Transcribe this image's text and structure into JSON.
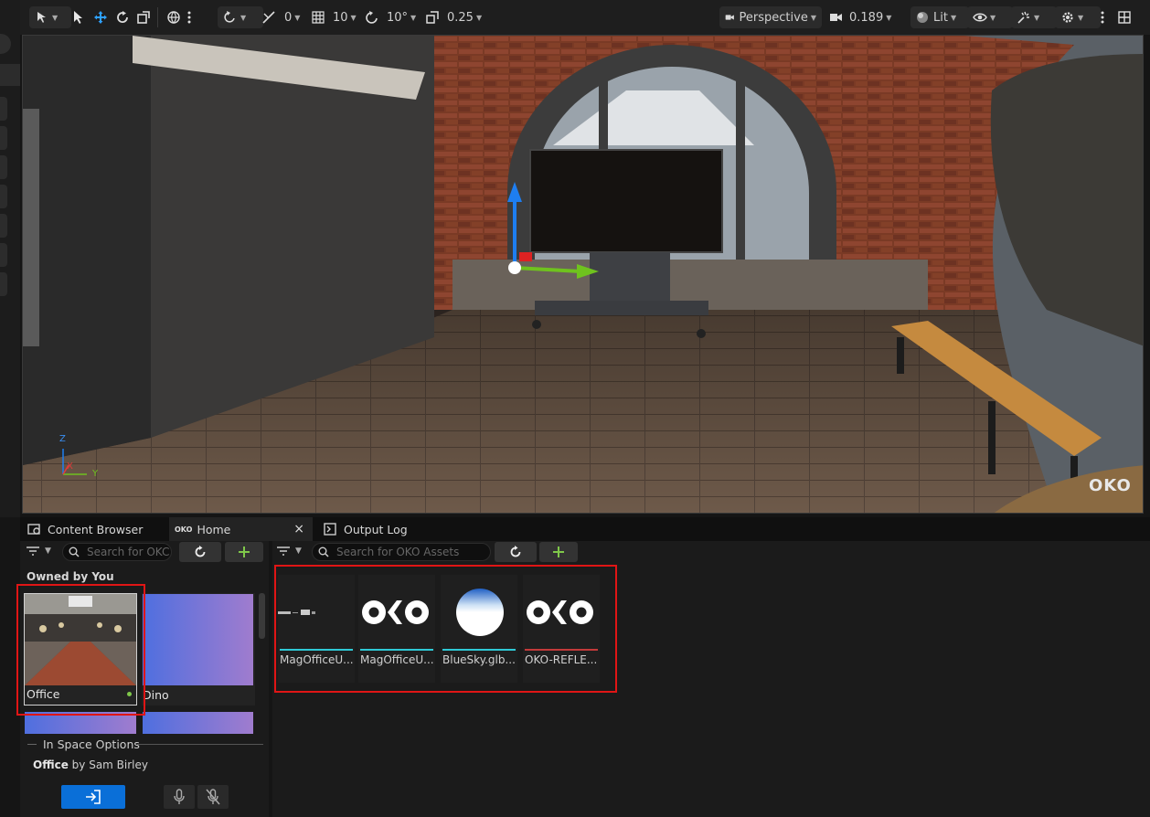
{
  "toolbar": {
    "snap_value": "0",
    "grid_value": "10",
    "rotation_value": "10°",
    "scale_value": "0.25",
    "perspective_label": "Perspective",
    "camera_speed": "0.189",
    "lit_label": "Lit"
  },
  "viewport": {
    "watermark": "OKO",
    "axis_labels": [
      "Z",
      "X",
      "Y"
    ]
  },
  "tabs": {
    "content_browser": "Content Browser",
    "home": "Home",
    "home_close": "×",
    "output_log": "Output Log"
  },
  "left_panel": {
    "search_placeholder": "Search for OKC",
    "section_title": "Owned by You",
    "spaces": [
      {
        "label": "Office"
      },
      {
        "label": "Dino"
      }
    ],
    "in_space_options": "In Space Options",
    "space_name": "Office",
    "space_owner": "by Sam Birley"
  },
  "right_panel": {
    "search_placeholder": "Search for OKO Assets",
    "assets": [
      {
        "label": "MagOfficeU..."
      },
      {
        "label": "MagOfficeU..."
      },
      {
        "label": "BlueSky.glb..."
      },
      {
        "label": "OKO-REFLE..."
      }
    ]
  },
  "colors": {
    "accent_blue": "#0a6fd8",
    "add_green": "#7fc84a",
    "highlight_red": "#e01515",
    "asset_bar_cyan": "#2fc9d6",
    "asset_bar_red": "#c23a3a"
  }
}
